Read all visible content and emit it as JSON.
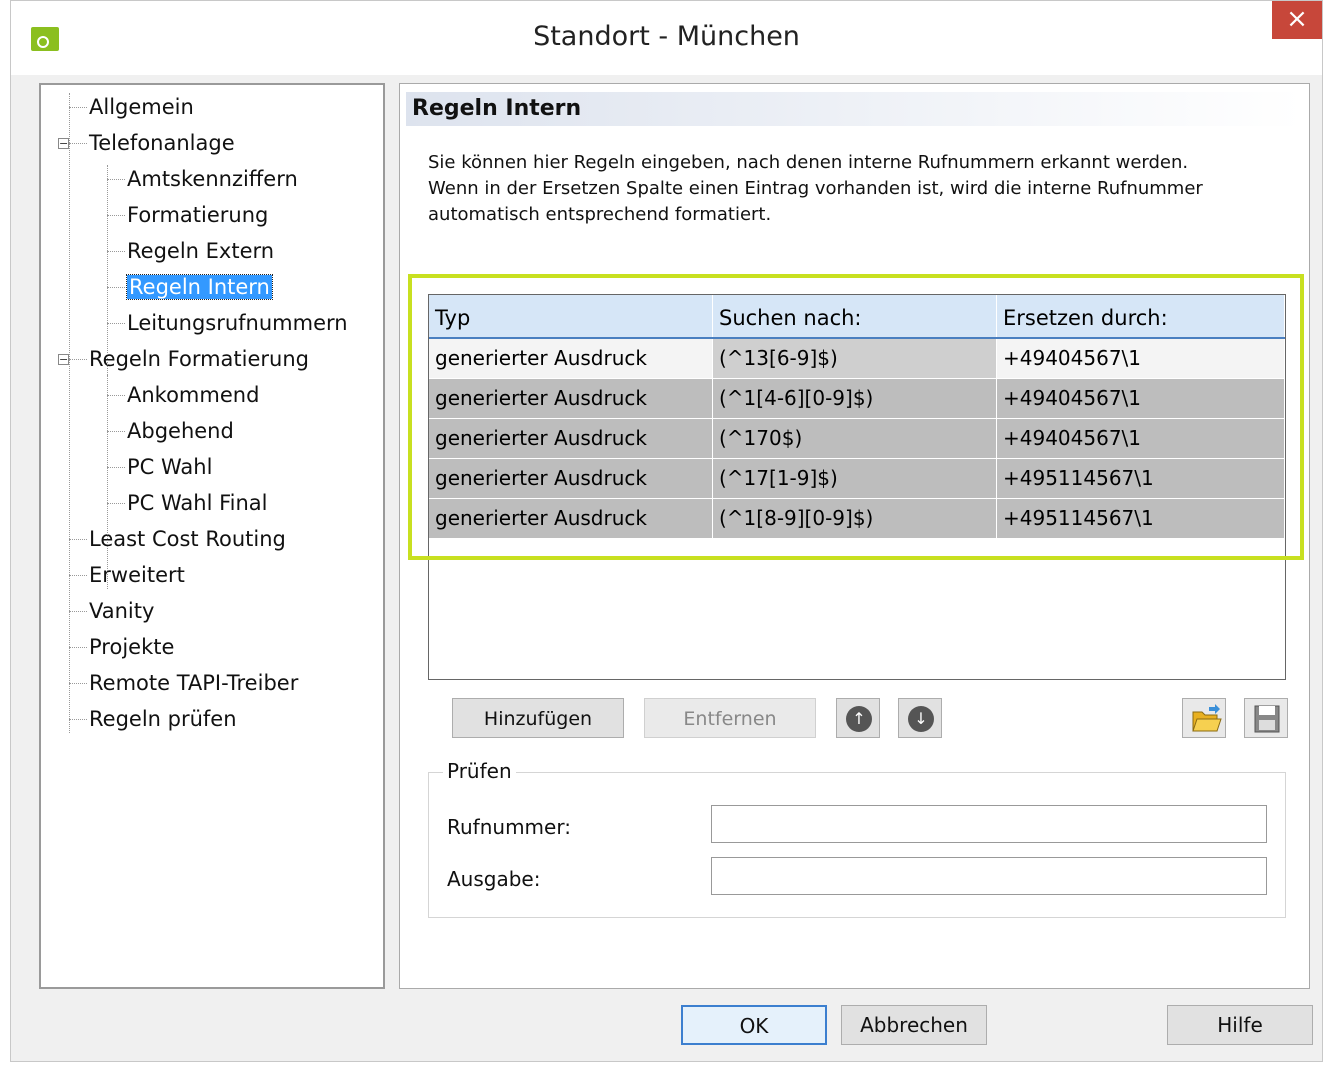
{
  "window": {
    "title": "Standort - München",
    "close": "×"
  },
  "tree": [
    {
      "label": "Allgemein",
      "level": 0
    },
    {
      "label": "Telefonanlage",
      "level": 0,
      "expander": "−"
    },
    {
      "label": "Amtskennziffern",
      "level": 1
    },
    {
      "label": "Formatierung",
      "level": 1
    },
    {
      "label": "Regeln Extern",
      "level": 1
    },
    {
      "label": "Regeln Intern",
      "level": 1,
      "selected": true
    },
    {
      "label": "Leitungsrufnummern",
      "level": 1
    },
    {
      "label": "Regeln Formatierung",
      "level": 0,
      "expander": "−"
    },
    {
      "label": "Ankommend",
      "level": 1
    },
    {
      "label": "Abgehend",
      "level": 1
    },
    {
      "label": "PC Wahl",
      "level": 1
    },
    {
      "label": "PC Wahl Final",
      "level": 1
    },
    {
      "label": "Least Cost Routing",
      "level": 0
    },
    {
      "label": "Erweitert",
      "level": 0
    },
    {
      "label": "Vanity",
      "level": 0
    },
    {
      "label": "Projekte",
      "level": 0
    },
    {
      "label": "Remote TAPI-Treiber",
      "level": 0
    },
    {
      "label": "Regeln prüfen",
      "level": 0
    }
  ],
  "content": {
    "title": "Regeln Intern",
    "desc": [
      "Sie können hier Regeln eingeben, nach denen interne Rufnummern erkannt werden.",
      "Wenn in der Ersetzen Spalte einen Eintrag vorhanden ist, wird die interne Rufnummer",
      "automatisch entsprechend formatiert."
    ],
    "table": {
      "headers": [
        "Typ",
        "Suchen nach:",
        "Ersetzen durch:"
      ],
      "rows": [
        [
          "generierter Ausdruck",
          "(^13[6-9]$)",
          "+49404567\\1"
        ],
        [
          "generierter Ausdruck",
          "(^1[4-6][0-9]$)",
          "+49404567\\1"
        ],
        [
          "generierter Ausdruck",
          "(^170$)",
          "+49404567\\1"
        ],
        [
          "generierter Ausdruck",
          "(^17[1-9]$)",
          "+495114567\\1"
        ],
        [
          "generierter Ausdruck",
          "(^1[8-9][0-9]$)",
          "+495114567\\1"
        ]
      ]
    },
    "buttons": {
      "add": "Hinzufügen",
      "remove": "Entfernen",
      "up": "↑",
      "down": "↓"
    },
    "check": {
      "legend": "Prüfen",
      "number_label": "Rufnummer:",
      "number_value": "",
      "output_label": "Ausgabe:",
      "output_value": ""
    }
  },
  "footer": {
    "ok": "OK",
    "cancel": "Abbrechen",
    "help": "Hilfe"
  },
  "colors": {
    "accent": "#8bbf1f",
    "highlight": "#c8e020",
    "selection": "#3399ff",
    "close": "#c7473a"
  }
}
